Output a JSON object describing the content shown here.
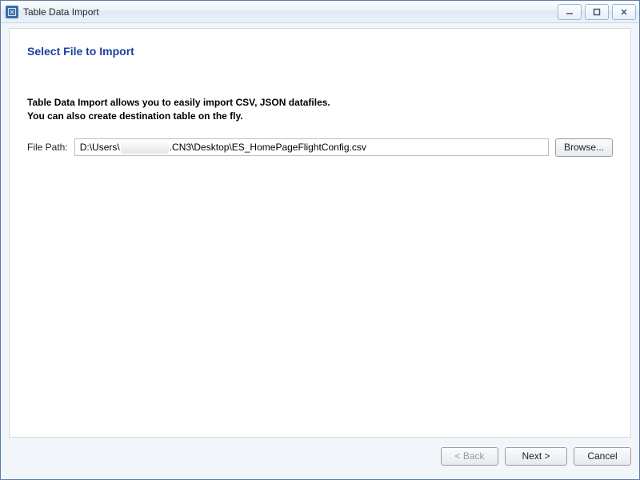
{
  "window": {
    "title": "Table Data Import"
  },
  "main": {
    "heading": "Select File to Import",
    "description_line1": "Table Data Import allows you to easily import CSV, JSON datafiles.",
    "description_line2": "You can also create destination table on the fly.",
    "file_label": "File Path:",
    "file_path_prefix": "D:\\Users\\",
    "file_path_mid": ".CN3\\Desktop\\ES_HomePageFlightConfig.csv",
    "browse_label": "Browse..."
  },
  "buttons": {
    "back": "< Back",
    "next": "Next >",
    "cancel": "Cancel"
  }
}
